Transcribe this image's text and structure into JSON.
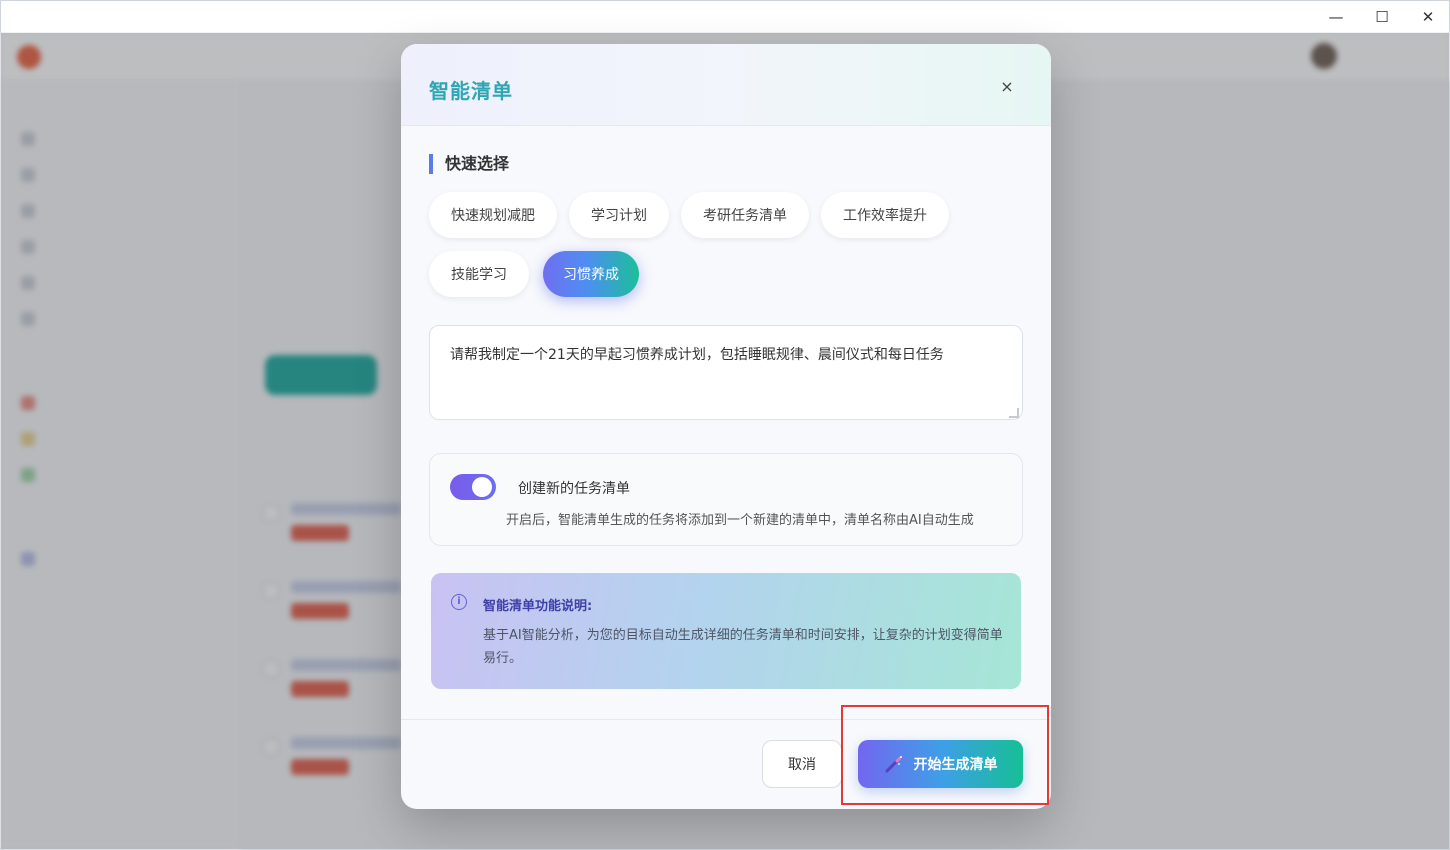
{
  "window": {
    "controls": {
      "minimize": "—",
      "maximize": "☐",
      "close": "✕"
    }
  },
  "modal": {
    "title": "智能清单",
    "close_glyph": "×",
    "quick_select": {
      "title": "快速选择",
      "chips": [
        {
          "label": "快速规划减肥",
          "active": false
        },
        {
          "label": "学习计划",
          "active": false
        },
        {
          "label": "考研任务清单",
          "active": false
        },
        {
          "label": "工作效率提升",
          "active": false
        },
        {
          "label": "技能学习",
          "active": false
        },
        {
          "label": "习惯养成",
          "active": true
        }
      ]
    },
    "prompt": {
      "value": "请帮我制定一个21天的早起习惯养成计划，包括睡眠规律、晨间仪式和每日任务"
    },
    "toggle": {
      "label": "创建新的任务清单",
      "description": "开启后，智能清单生成的任务将添加到一个新建的清单中，清单名称由AI自动生成",
      "enabled": true
    },
    "info": {
      "icon": "info-icon",
      "title": "智能清单功能说明:",
      "text": "基于AI智能分析，为您的目标自动生成详细的任务清单和时间安排，让复杂的计划变得简单易行。"
    },
    "footer": {
      "cancel_label": "取消",
      "start_label": "开始生成清单",
      "start_icon": "magic-wand-icon"
    }
  },
  "colors": {
    "title": "#2fa6b3",
    "accent_purple": "#7366ef",
    "accent_green": "#16bf95",
    "highlight": "#e53935"
  }
}
